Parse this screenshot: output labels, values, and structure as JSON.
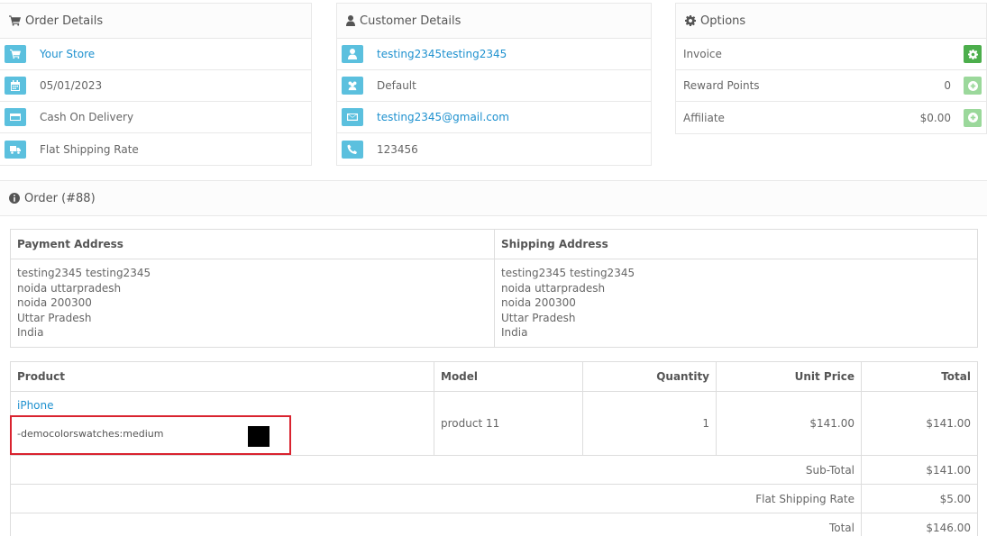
{
  "order_details": {
    "title": "Order Details",
    "store": "Your Store",
    "date": "05/01/2023",
    "payment": "Cash On Delivery",
    "shipping": "Flat Shipping Rate"
  },
  "customer_details": {
    "title": "Customer Details",
    "name": "testing2345testing2345",
    "group": "Default",
    "email": "testing2345@gmail.com",
    "phone": "123456"
  },
  "options": {
    "title": "Options",
    "invoice_label": "Invoice",
    "reward_label": "Reward Points",
    "reward_value": "0",
    "affiliate_label": "Affiliate",
    "affiliate_value": "$0.00"
  },
  "order": {
    "title": "Order (#88)",
    "payment_address_label": "Payment Address",
    "shipping_address_label": "Shipping Address",
    "payment_address": [
      "testing2345 testing2345",
      "noida uttarpradesh",
      "noida 200300",
      "Uttar Pradesh",
      "India"
    ],
    "shipping_address": [
      "testing2345 testing2345",
      "noida uttarpradesh",
      "noida 200300",
      "Uttar Pradesh",
      "India"
    ]
  },
  "products": {
    "headers": [
      "Product",
      "Model",
      "Quantity",
      "Unit Price",
      "Total"
    ],
    "rows": [
      {
        "name": "iPhone",
        "option": "-democolorswatches:medium",
        "model": "product 11",
        "quantity": "1",
        "unit_price": "$141.00",
        "total": "$141.00"
      }
    ],
    "totals": [
      {
        "label": "Sub-Total",
        "value": "$141.00"
      },
      {
        "label": "Flat Shipping Rate",
        "value": "$5.00"
      },
      {
        "label": "Total",
        "value": "$146.00"
      }
    ]
  },
  "colors": {
    "accent": "#1e91cf",
    "info": "#5bc0de",
    "success": "#4cae4c",
    "highlight": "#d9232f"
  }
}
